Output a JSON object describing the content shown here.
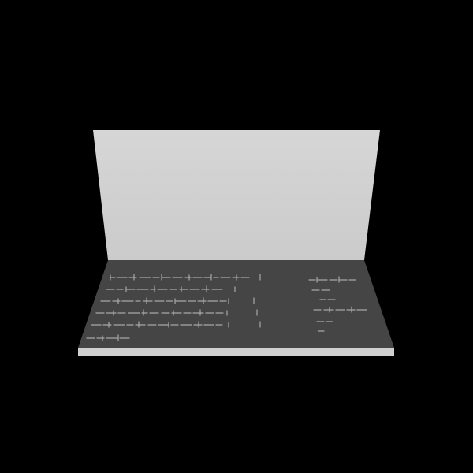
{
  "colors": {
    "background": "#000000",
    "back_panel_top": "#d6d6d6",
    "back_panel_bottom": "#cbcbcb",
    "base_surface": "#454545",
    "base_front_edge": "#cfcfcf",
    "text_strokes": "#a8a8a8"
  },
  "text_block": {
    "legible": false
  }
}
